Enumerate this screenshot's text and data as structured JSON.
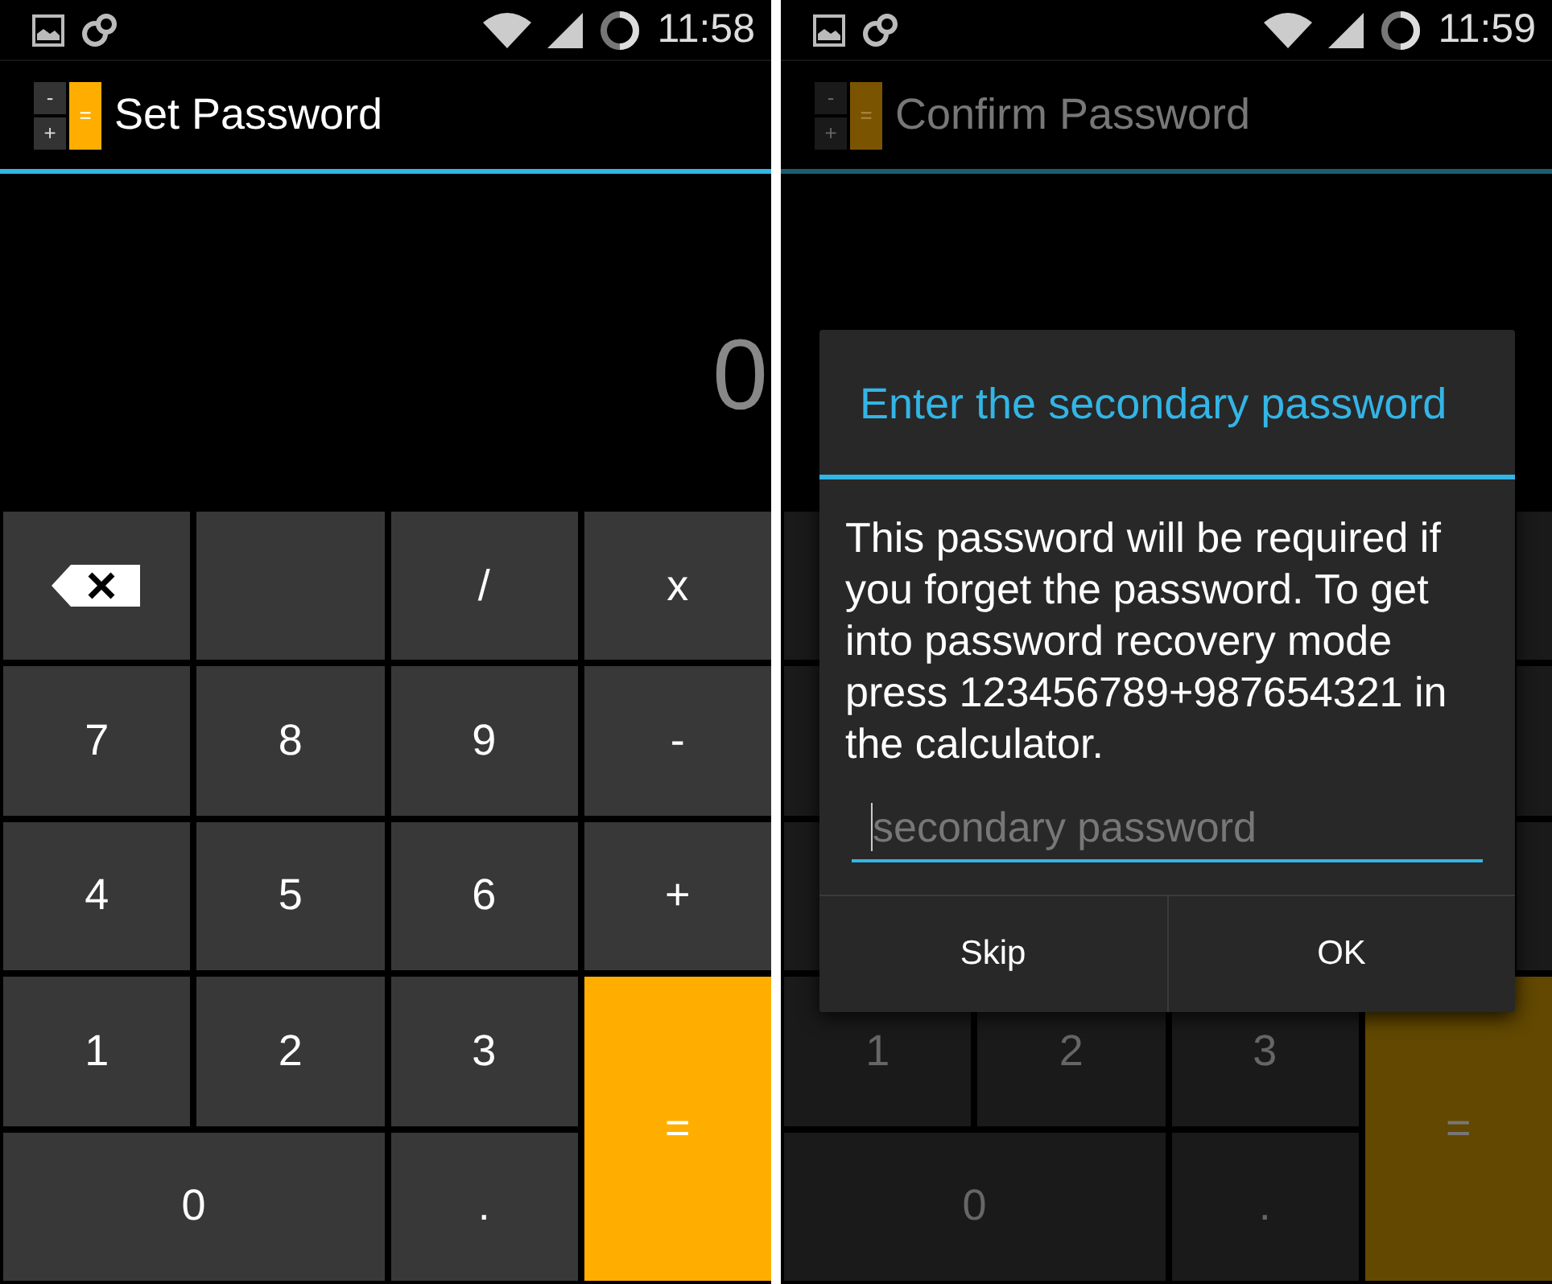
{
  "screens": [
    {
      "status_bar": {
        "time": "11:58"
      },
      "logo": [
        "-",
        "+",
        "="
      ],
      "title": "Set Password",
      "display": "0",
      "dimmed": false,
      "keys": [
        {
          "kind": "backspace"
        },
        {
          "kind": "blank"
        },
        {
          "kind": "key",
          "label": "/"
        },
        {
          "kind": "key",
          "label": "x"
        },
        {
          "kind": "key",
          "label": "7"
        },
        {
          "kind": "key",
          "label": "8"
        },
        {
          "kind": "key",
          "label": "9"
        },
        {
          "kind": "key",
          "label": "-"
        },
        {
          "kind": "key",
          "label": "4"
        },
        {
          "kind": "key",
          "label": "5"
        },
        {
          "kind": "key",
          "label": "6"
        },
        {
          "kind": "key",
          "label": "+"
        },
        {
          "kind": "key",
          "label": "1"
        },
        {
          "kind": "key",
          "label": "2"
        },
        {
          "kind": "key",
          "label": "3"
        },
        {
          "kind": "equals",
          "label": "="
        },
        {
          "kind": "wide",
          "label": "0"
        },
        {
          "kind": "key",
          "label": "."
        }
      ]
    },
    {
      "status_bar": {
        "time": "11:59"
      },
      "logo": [
        "-",
        "+",
        "="
      ],
      "title": "Confirm Password",
      "dimmed": true,
      "keys": [
        {
          "kind": "key",
          "label": "1"
        },
        {
          "kind": "key",
          "label": "2"
        },
        {
          "kind": "key",
          "label": "3"
        },
        {
          "kind": "equals",
          "label": "="
        },
        {
          "kind": "wide",
          "label": "0"
        },
        {
          "kind": "key",
          "label": "."
        }
      ],
      "dialog": {
        "title": "Enter the secondary password",
        "message": "This password will be required if you forget the password. To get into password recovery mode press 123456789+987654321 in the calculator.",
        "placeholder": "secondary password",
        "buttons": [
          "Skip",
          "OK"
        ]
      }
    }
  ]
}
